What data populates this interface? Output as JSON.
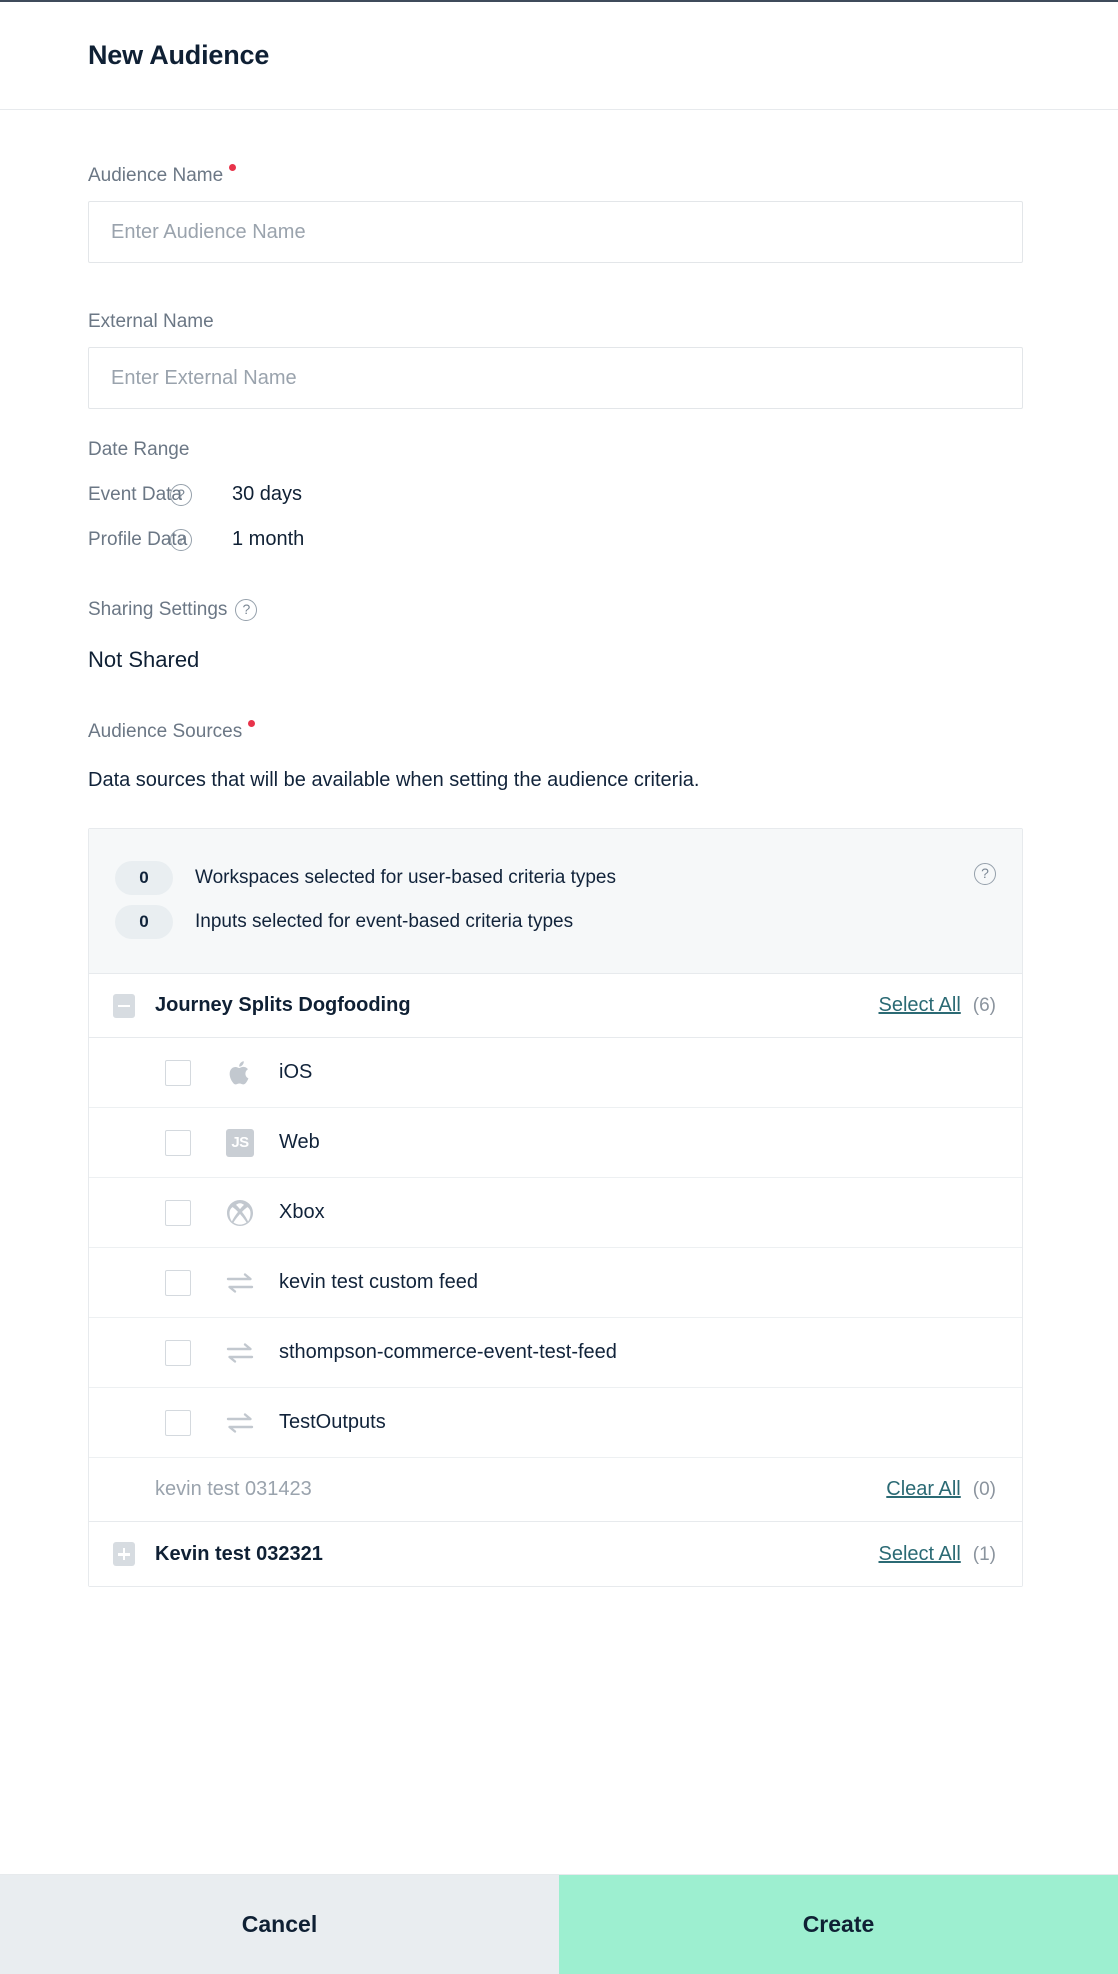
{
  "header": {
    "title": "New Audience"
  },
  "form": {
    "audience_name": {
      "label": "Audience Name",
      "required": true,
      "value": "",
      "placeholder": "Enter Audience Name"
    },
    "external_name": {
      "label": "External Name",
      "required": false,
      "value": "",
      "placeholder": "Enter External Name"
    },
    "date_range": {
      "label": "Date Range",
      "rows": [
        {
          "label": "Event Data",
          "value": "30 days",
          "help": "?"
        },
        {
          "label": "Profile Data",
          "value": "1 month",
          "help": "?"
        }
      ]
    },
    "sharing_settings": {
      "label": "Sharing Settings",
      "help": "?",
      "value": "Not Shared"
    },
    "audience_sources": {
      "label": "Audience Sources",
      "required": true,
      "description": "Data sources that will be available when setting the audience criteria.",
      "summary": {
        "help": "?",
        "rows": [
          {
            "count": "0",
            "text": "Workspaces selected for user-based criteria types"
          },
          {
            "count": "0",
            "text": "Inputs selected for event-based criteria types"
          }
        ]
      },
      "groups": [
        {
          "name": "Journey Splits Dogfooding",
          "expanded": true,
          "toggle_icon": "minus-box-icon",
          "action_label": "Select All",
          "count_label": "(6)",
          "muted": false,
          "items": [
            {
              "name": "iOS",
              "icon": "apple-icon",
              "checked": false
            },
            {
              "name": "Web",
              "icon": "js-badge-icon",
              "checked": false
            },
            {
              "name": "Xbox",
              "icon": "xbox-icon",
              "checked": false
            },
            {
              "name": "kevin test custom feed",
              "icon": "data-feed-icon",
              "checked": false
            },
            {
              "name": "sthompson-commerce-event-test-feed",
              "icon": "data-feed-icon",
              "checked": false
            },
            {
              "name": "TestOutputs",
              "icon": "data-feed-icon",
              "checked": false
            }
          ]
        },
        {
          "name": "kevin test 031423",
          "expanded": false,
          "toggle_icon": "none",
          "action_label": "Clear All",
          "count_label": "(0)",
          "muted": true,
          "items": []
        },
        {
          "name": "Kevin test 032321",
          "expanded": false,
          "toggle_icon": "plus-box-icon",
          "action_label": "Select All",
          "count_label": "(1)",
          "muted": false,
          "items": []
        }
      ]
    }
  },
  "footer": {
    "cancel_label": "Cancel",
    "create_label": "Create"
  },
  "colors": {
    "accent_create": "#9defd0",
    "link": "#2b6a74",
    "required_dot": "#e8334a",
    "title": "#0f2034"
  }
}
